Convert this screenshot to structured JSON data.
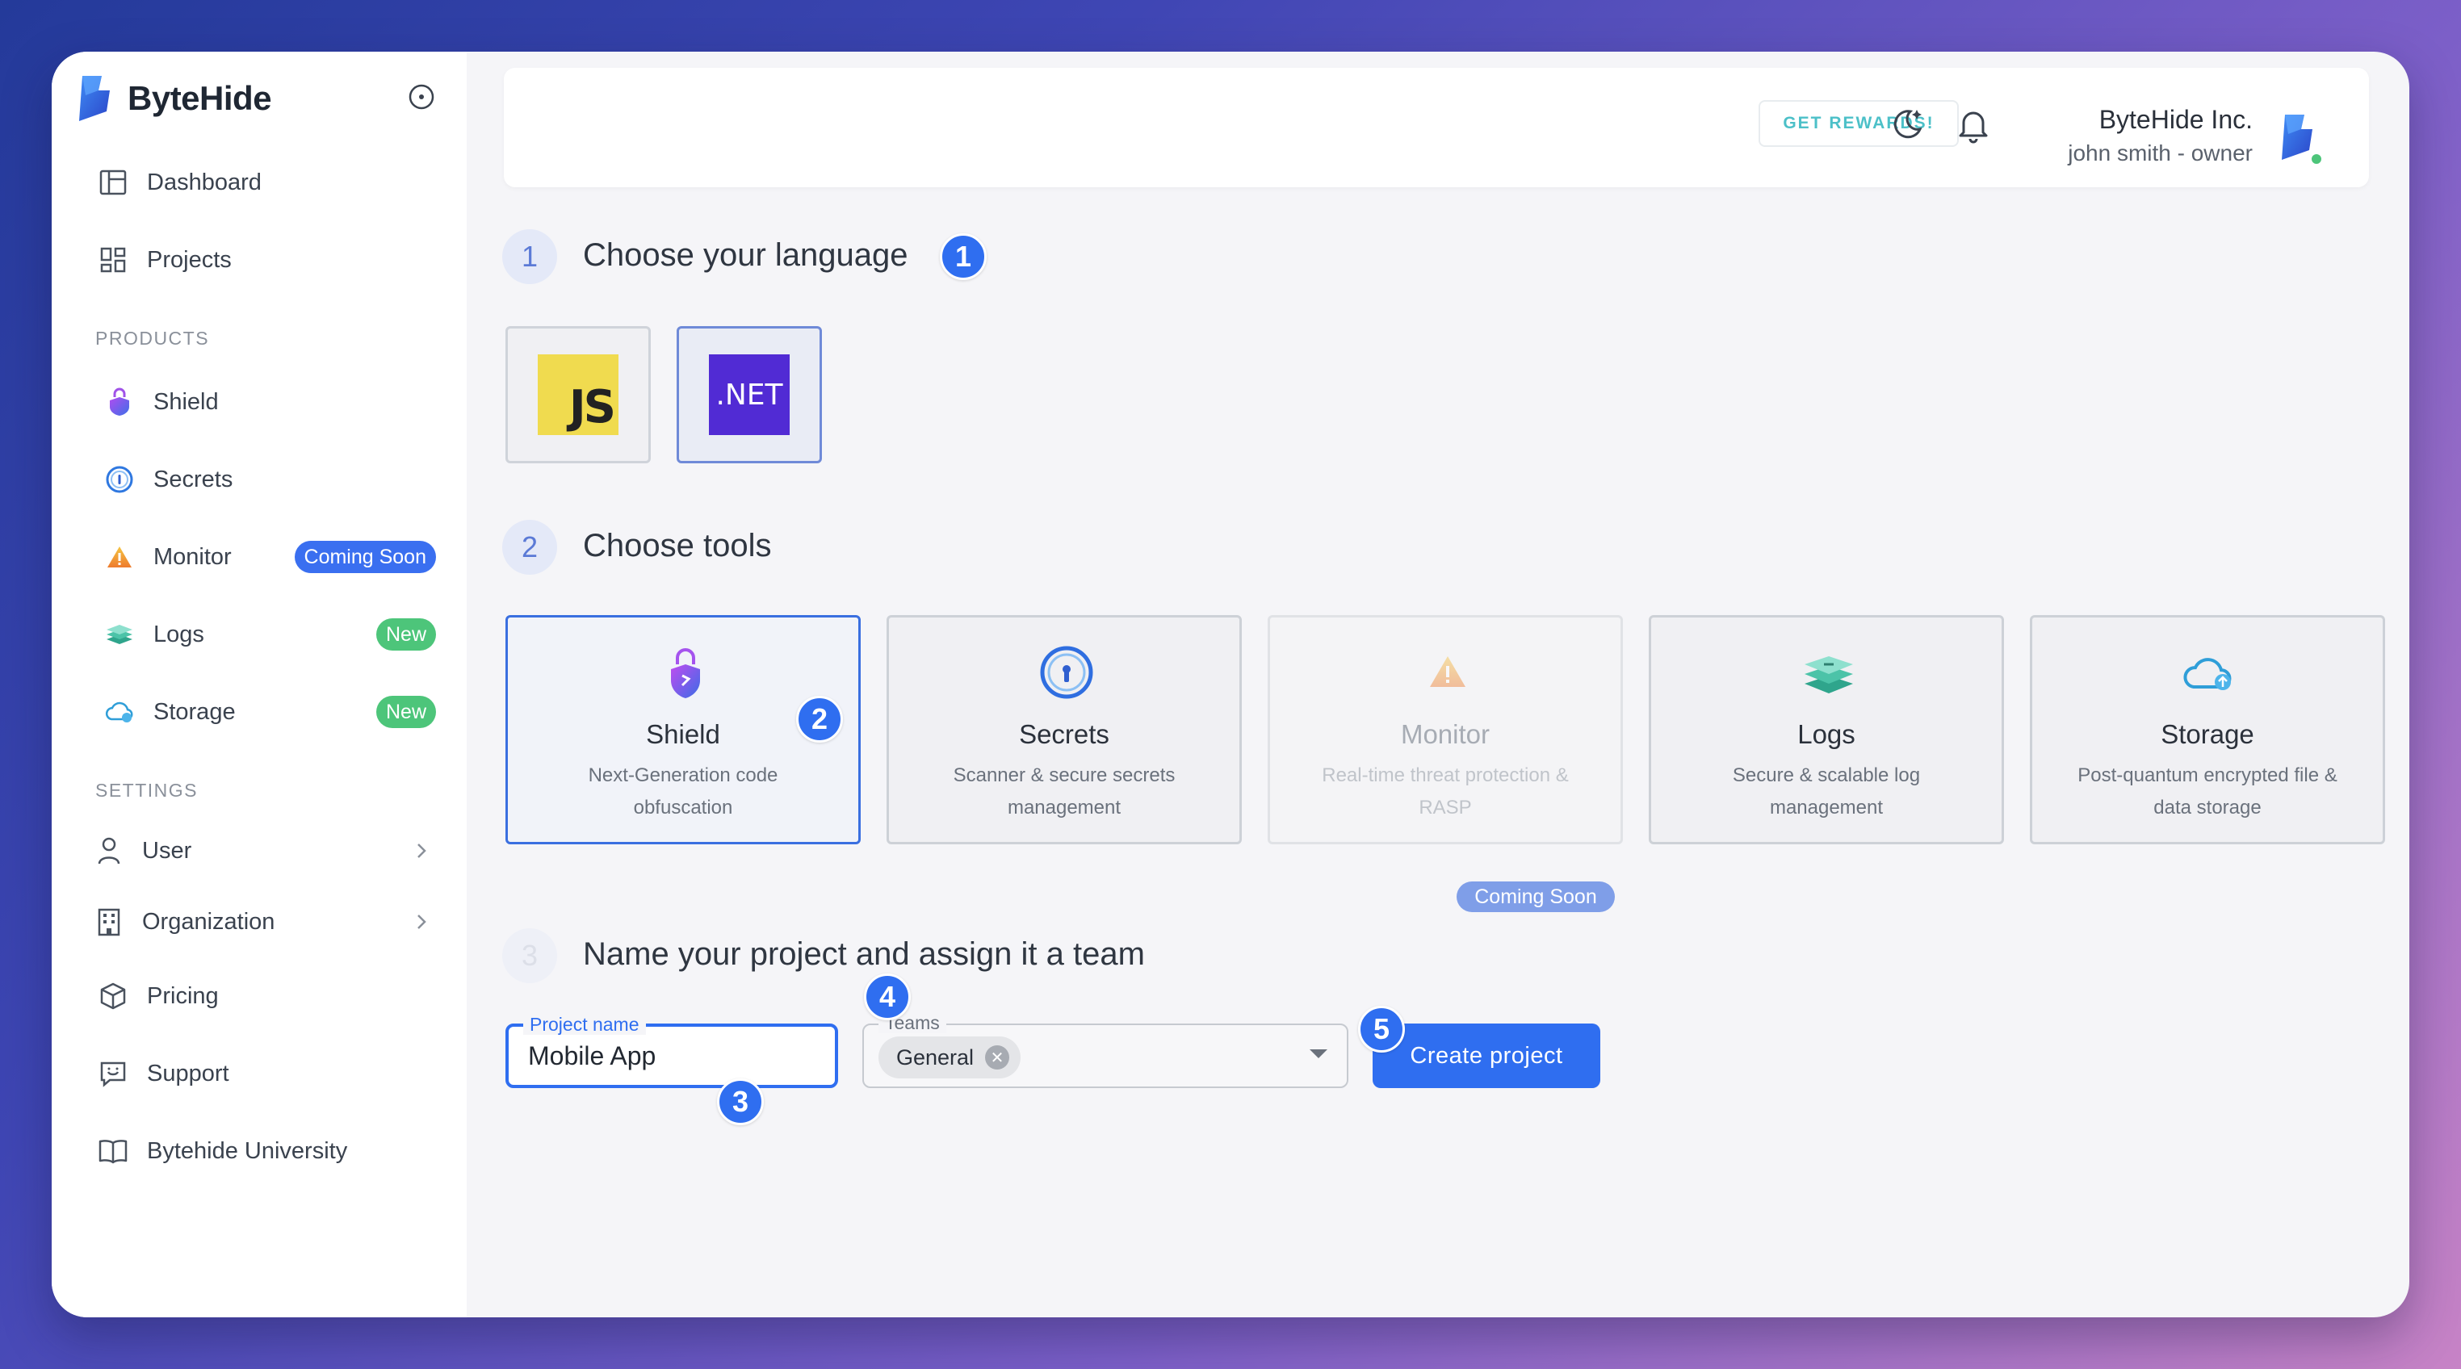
{
  "brand": {
    "name": "ByteHide"
  },
  "sidebar": {
    "nav": [
      {
        "label": "Dashboard",
        "icon": "dashboard-icon"
      },
      {
        "label": "Projects",
        "icon": "projects-icon"
      }
    ],
    "products_label": "PRODUCTS",
    "products": [
      {
        "label": "Shield",
        "icon": "shield-icon"
      },
      {
        "label": "Secrets",
        "icon": "secrets-icon"
      },
      {
        "label": "Monitor",
        "icon": "monitor-icon",
        "badge": "Coming Soon"
      },
      {
        "label": "Logs",
        "icon": "logs-icon",
        "badge": "New"
      },
      {
        "label": "Storage",
        "icon": "storage-icon",
        "badge": "New"
      }
    ],
    "settings_label": "SETTINGS",
    "settings": [
      {
        "label": "User",
        "icon": "user-icon"
      },
      {
        "label": "Organization",
        "icon": "organization-icon"
      },
      {
        "label": "Pricing",
        "icon": "pricing-icon"
      },
      {
        "label": "Support",
        "icon": "support-icon"
      },
      {
        "label": "Bytehide University",
        "icon": "book-icon"
      }
    ]
  },
  "header": {
    "rewards": "GET REWARDS!",
    "org_name": "ByteHide Inc.",
    "org_user": "john smith - owner"
  },
  "steps": [
    {
      "number": "1",
      "title": "Choose your language"
    },
    {
      "number": "2",
      "title": "Choose tools"
    },
    {
      "number": "3",
      "title": "Name your project and assign it a team"
    }
  ],
  "languages": [
    {
      "label": "JS",
      "selected": false
    },
    {
      "label": ".NET",
      "selected": true
    }
  ],
  "tools": [
    {
      "title": "Shield",
      "description": "Next-Generation code obfuscation",
      "selected": true
    },
    {
      "title": "Secrets",
      "description": "Scanner & secure secrets management"
    },
    {
      "title": "Monitor",
      "description": "Real-time threat protection & RASP",
      "disabled": true,
      "badge": "Coming Soon"
    },
    {
      "title": "Logs",
      "description": "Secure & scalable log management"
    },
    {
      "title": "Storage",
      "description": "Post-quantum encrypted file & data storage"
    }
  ],
  "form": {
    "project_label": "Project name",
    "project_value": "Mobile App",
    "teams_label": "Teams",
    "team_chip": "General",
    "create_button": "Create project"
  },
  "markers": [
    "1",
    "2",
    "3",
    "4",
    "5"
  ],
  "colors": {
    "accent": "#2f6ef0",
    "badge_new": "#4dc57a",
    "rewards": "#4cc0c8"
  }
}
